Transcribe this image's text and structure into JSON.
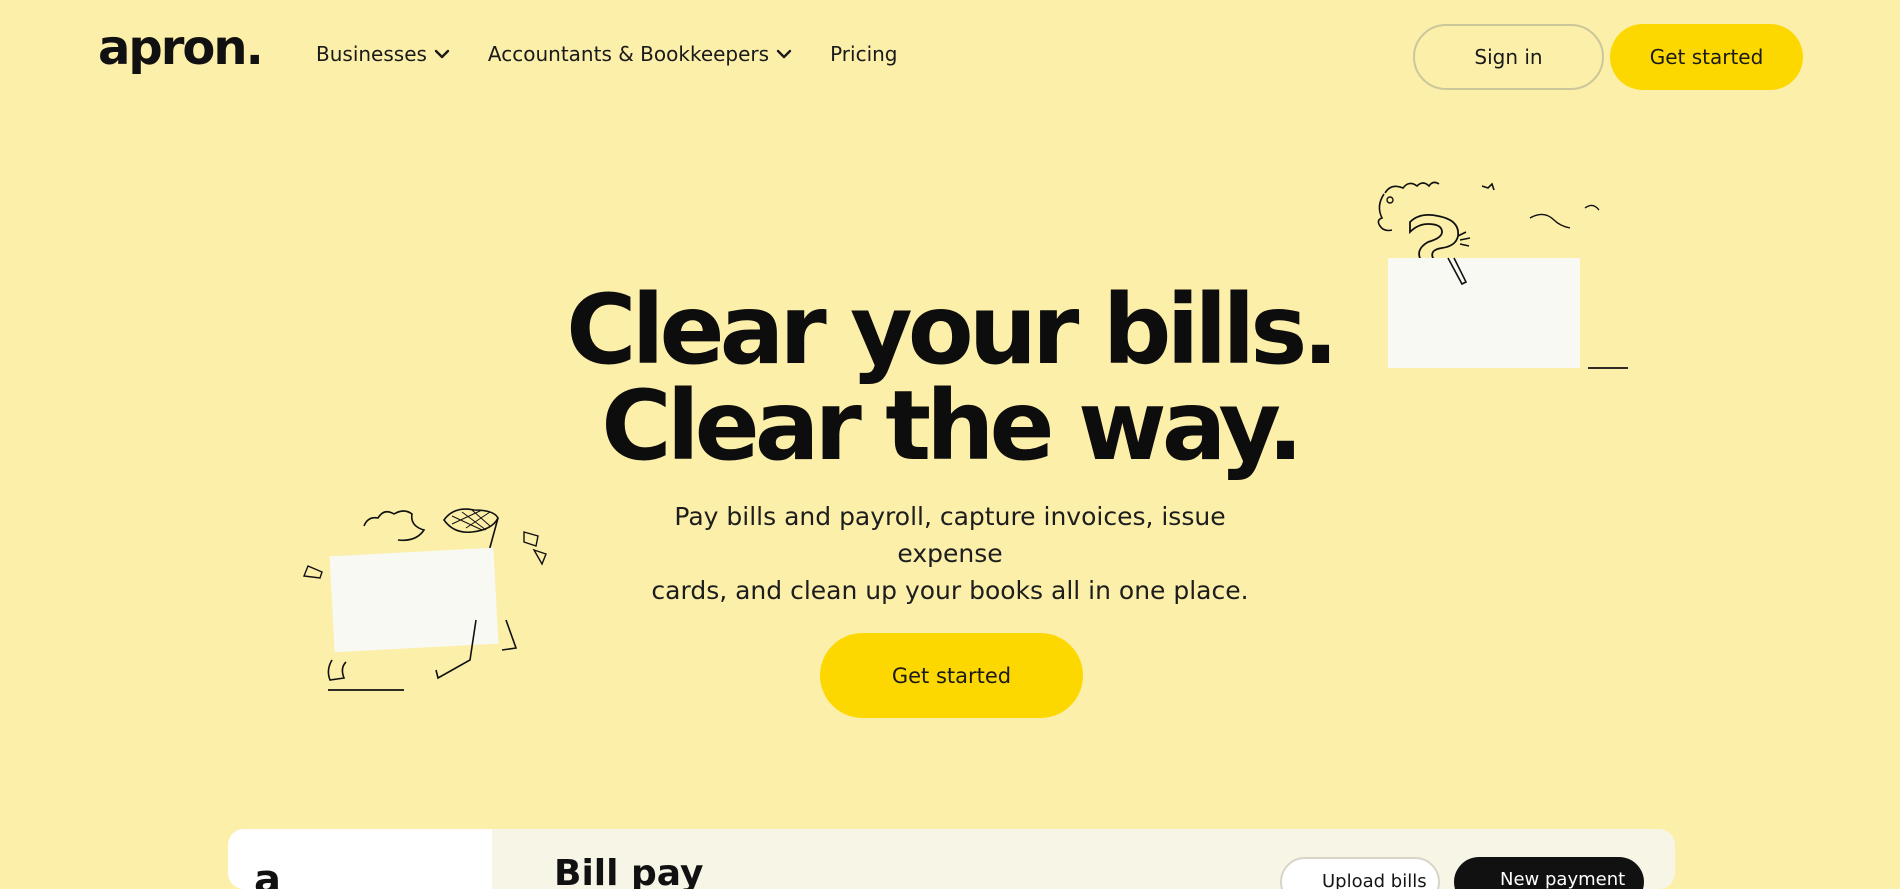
{
  "header": {
    "logo": "apron.",
    "nav": [
      {
        "label": "Businesses",
        "has_dropdown": true
      },
      {
        "label": "Accountants & Bookkeepers",
        "has_dropdown": true
      },
      {
        "label": "Pricing",
        "has_dropdown": false
      }
    ],
    "sign_in_label": "Sign in",
    "get_started_label": "Get started"
  },
  "hero": {
    "title_line1": "Clear your bills.",
    "title_line2": "Clear the way.",
    "subtitle_line1": "Pay bills and payroll, capture invoices, issue expense",
    "subtitle_line2": "cards, and clean up your books all in one place.",
    "cta_label": "Get started"
  },
  "preview": {
    "side_text": "a",
    "title": "Bill pay",
    "upload_label": "Upload bills",
    "new_label": "New payment"
  },
  "colors": {
    "background": "#fbefa9",
    "accent": "#fdd800",
    "text": "#0d0d0d"
  }
}
